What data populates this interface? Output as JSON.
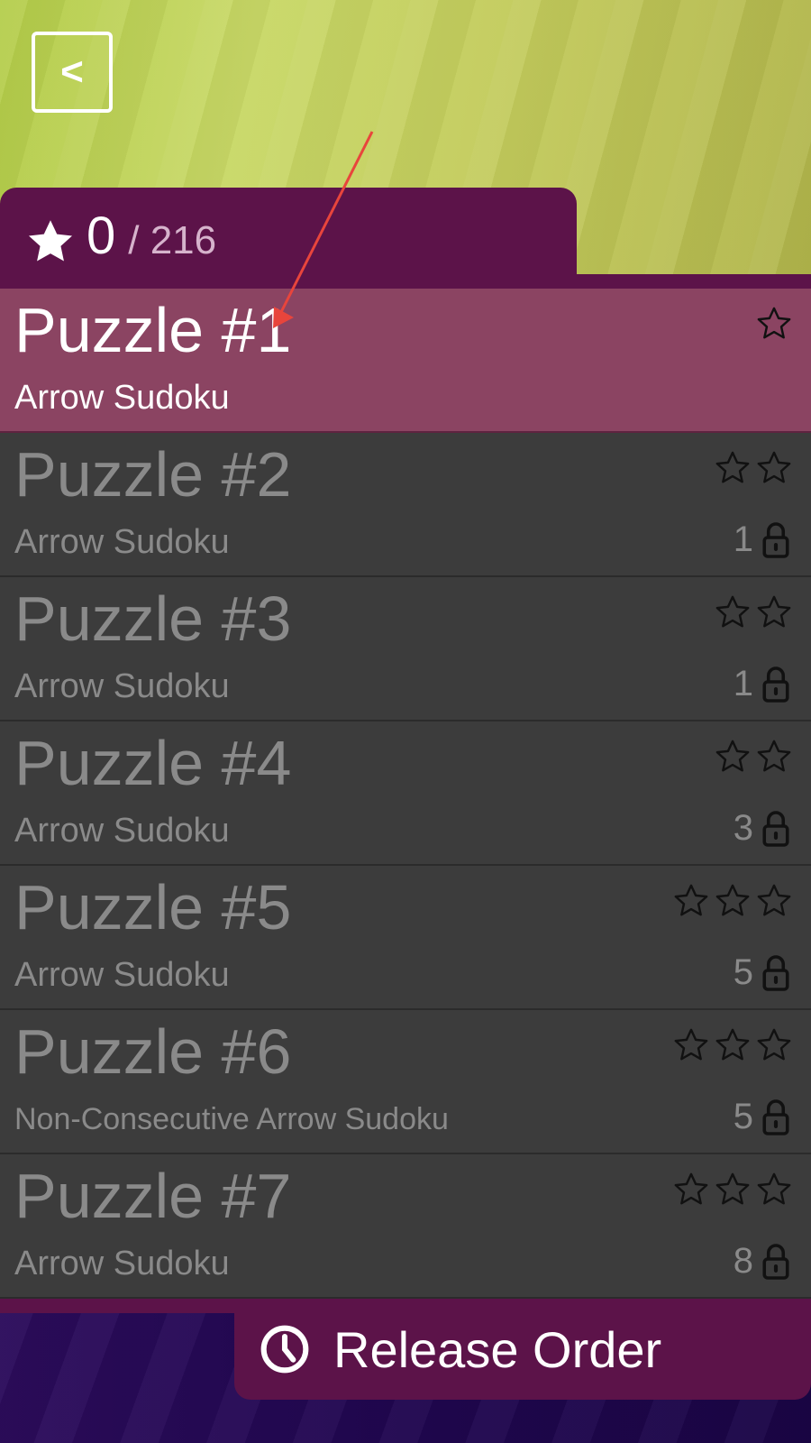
{
  "header": {
    "back_label": "<",
    "stars_earned": "0",
    "stars_total": "/ 216"
  },
  "puzzles": [
    {
      "title": "Puzzle #1",
      "subtitle": "Arrow Sudoku",
      "stars": 1,
      "unlock_cost": "",
      "locked": false,
      "active": true
    },
    {
      "title": "Puzzle #2",
      "subtitle": "Arrow Sudoku",
      "stars": 2,
      "unlock_cost": "1",
      "locked": true,
      "active": false
    },
    {
      "title": "Puzzle #3",
      "subtitle": "Arrow Sudoku",
      "stars": 2,
      "unlock_cost": "1",
      "locked": true,
      "active": false
    },
    {
      "title": "Puzzle #4",
      "subtitle": "Arrow Sudoku",
      "stars": 2,
      "unlock_cost": "3",
      "locked": true,
      "active": false
    },
    {
      "title": "Puzzle #5",
      "subtitle": "Arrow Sudoku",
      "stars": 3,
      "unlock_cost": "5",
      "locked": true,
      "active": false
    },
    {
      "title": "Puzzle #6",
      "subtitle": "Non-Consecutive Arrow Sudoku",
      "stars": 3,
      "unlock_cost": "5",
      "locked": true,
      "active": false
    },
    {
      "title": "Puzzle #7",
      "subtitle": "Arrow Sudoku",
      "stars": 3,
      "unlock_cost": "8",
      "locked": true,
      "active": false
    }
  ],
  "footer": {
    "release_order_label": "Release Order"
  },
  "icons": {
    "back": "chevron-left-icon",
    "star_filled": "star-filled-icon",
    "star_outline": "star-outline-icon",
    "lock": "lock-icon",
    "clock": "clock-icon"
  },
  "colors": {
    "header_purple": "#5c1349",
    "active_row": "#8b4462",
    "row_bg": "#3c3c3c",
    "muted_text": "#8a8a8a",
    "annotation_arrow": "#e8453c"
  }
}
